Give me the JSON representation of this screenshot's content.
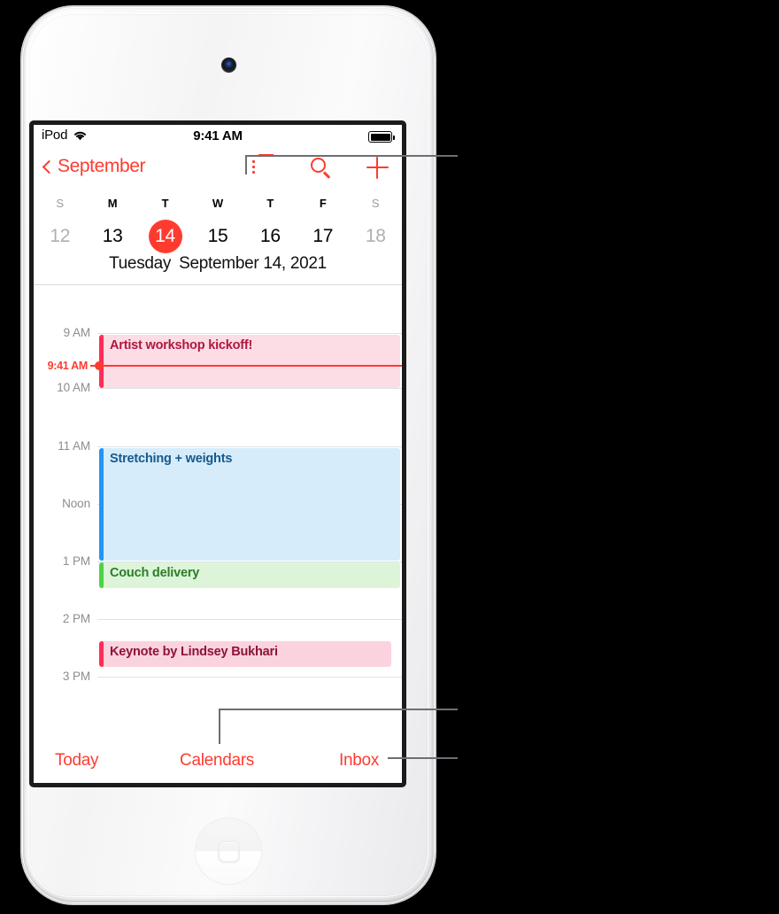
{
  "device": {
    "name": "iPod touch"
  },
  "status_bar": {
    "carrier": "iPod",
    "wifi_icon": "wifi-icon",
    "time": "9:41 AM",
    "battery_icon": "battery-full-icon"
  },
  "nav_bar": {
    "back_icon": "chevron-left-icon",
    "back_label": "September",
    "list_button_icon": "list-view-icon",
    "search_button_icon": "search-icon",
    "add_button_icon": "plus-icon"
  },
  "week_strip": {
    "weekday_initials": [
      "S",
      "M",
      "T",
      "W",
      "T",
      "F",
      "S"
    ],
    "days": [
      {
        "num": "12",
        "state": "dim"
      },
      {
        "num": "13",
        "state": "normal"
      },
      {
        "num": "14",
        "state": "selected"
      },
      {
        "num": "15",
        "state": "normal"
      },
      {
        "num": "16",
        "state": "normal"
      },
      {
        "num": "17",
        "state": "normal"
      },
      {
        "num": "18",
        "state": "dim"
      }
    ]
  },
  "date_title": {
    "weekday": "Tuesday",
    "date": "September 14, 2021"
  },
  "timeline": {
    "hour_labels": [
      "9 AM",
      "10 AM",
      "11 AM",
      "Noon",
      "1 PM",
      "2 PM",
      "3 PM"
    ],
    "now_indicator": {
      "label": "9:41 AM",
      "color": "#ff3b30"
    },
    "events": [
      {
        "title": "Artist workshop kickoff!",
        "bar_color": "#ff2d55",
        "fill_color": "#fcdce5",
        "text_color": "#b0173f"
      },
      {
        "title": "Stretching + weights",
        "bar_color": "#2196f3",
        "fill_color": "#d6ecfb",
        "text_color": "#16598c"
      },
      {
        "title": "Couch delivery",
        "bar_color": "#4cd445",
        "fill_color": "#ddf4d9",
        "text_color": "#2b7d27"
      },
      {
        "title": "Keynote by Lindsey Bukhari",
        "bar_color": "#ff2d55",
        "fill_color": "#fbd3de",
        "text_color": "#8e1338"
      },
      {
        "title": "",
        "bar_color": "#4cd445",
        "fill_color": "#e7f7e2",
        "text_color": "#2b7d27"
      },
      {
        "title": "",
        "bar_color": "#ffb300",
        "fill_color": "#fdf2d4",
        "text_color": "#9a6a00"
      }
    ]
  },
  "toolbar": {
    "today_label": "Today",
    "calendars_label": "Calendars",
    "inbox_label": "Inbox"
  },
  "colors": {
    "accent": "#ff3b30",
    "grid_line": "#e2e2e6",
    "hour_text": "#8d8d92",
    "callout": "#6e6e73"
  }
}
